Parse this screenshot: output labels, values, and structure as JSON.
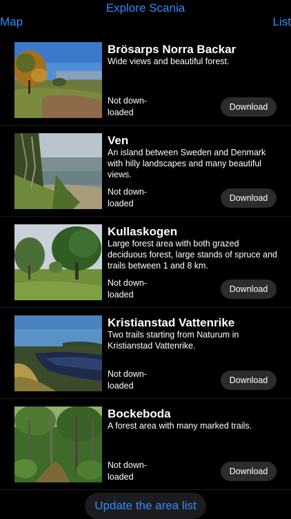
{
  "nav": {
    "title": "Explore Scania",
    "left_label": "Map",
    "right_label": "List"
  },
  "areas": [
    {
      "name": "Brösarps Norra Backar",
      "description": "Wide views and beautiful forest.",
      "status": "Not down-loaded",
      "action": "Download"
    },
    {
      "name": "Ven",
      "description": "An island between Sweden and Denmark with hilly landscapes and many beautiful views.",
      "status": "Not down-loaded",
      "action": "Download"
    },
    {
      "name": "Kullaskogen",
      "description": "Large forest area with both grazed deciduous forest, large stands of spruce and trails between 1 and 8 km.",
      "status": "Not down-loaded",
      "action": "Download"
    },
    {
      "name": "Kristianstad Vattenrike",
      "description": "Two trails starting from Naturum in Kristianstad Vattenrike.",
      "status": "Not down-loaded",
      "action": "Download"
    },
    {
      "name": "Bockeboda",
      "description": "A forest area with many marked trails.",
      "status": "Not down-loaded",
      "action": "Download"
    }
  ],
  "footer": {
    "update_label": "Update the area list"
  },
  "colors": {
    "accent": "#2f8cff",
    "background": "#000000",
    "button": "#2c2c2e"
  }
}
